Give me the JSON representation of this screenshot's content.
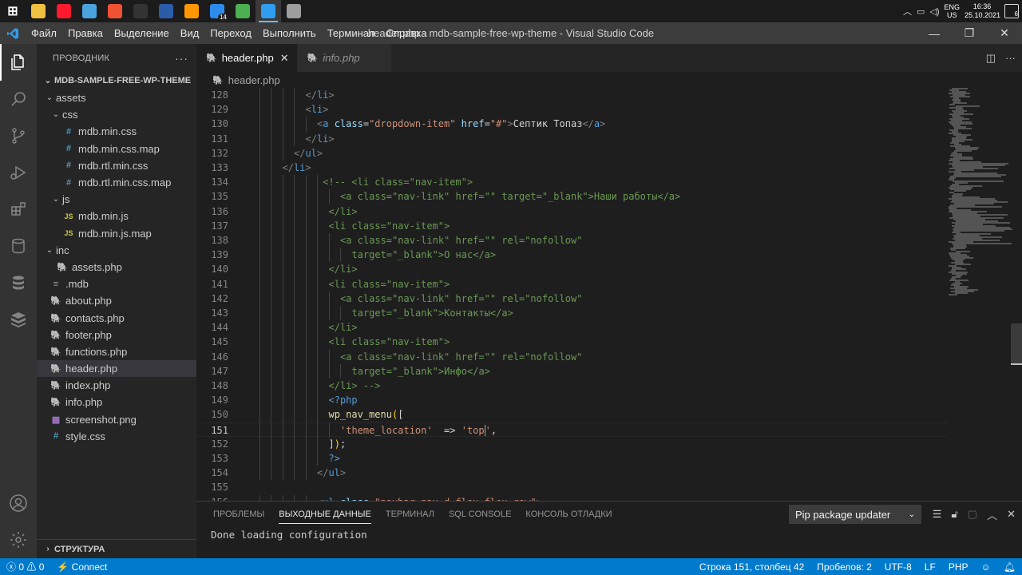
{
  "taskbar": {
    "apps": [
      {
        "icon": "windows-start-icon",
        "color": "#ffffff"
      },
      {
        "icon": "file-explorer-icon",
        "color": "#f0c040"
      },
      {
        "icon": "opera-icon",
        "color": "#ff1b2d"
      },
      {
        "icon": "notepad-icon",
        "color": "#4aa3df"
      },
      {
        "icon": "git-icon",
        "color": "#f05133"
      },
      {
        "icon": "terminal-icon",
        "color": "#333333"
      },
      {
        "icon": "b-app-icon",
        "color": "#2a5caa"
      },
      {
        "icon": "sublime-icon",
        "color": "#ff9800"
      },
      {
        "icon": "check-app-icon",
        "color": "#2d8ceb",
        "badge": "14"
      },
      {
        "icon": "chrome-icon",
        "color": "#4caf50"
      },
      {
        "icon": "vscode-icon",
        "color": "#2f9ef0",
        "active": true
      },
      {
        "icon": "app-window-icon",
        "color": "#9e9e9e"
      }
    ],
    "tray": {
      "lang": "ENG",
      "region": "US",
      "time": "16:36",
      "date": "25.10.2021",
      "notifications": "6"
    }
  },
  "titlebar": {
    "menu": [
      "Файл",
      "Правка",
      "Выделение",
      "Вид",
      "Переход",
      "Выполнить",
      "Терминал",
      "Справка"
    ],
    "title": "header.php - mdb-sample-free-wp-theme - Visual Studio Code"
  },
  "sidebar": {
    "header": "ПРОВОДНИК",
    "root": "MDB-SAMPLE-FREE-WP-THEME",
    "tree": [
      {
        "label": "assets",
        "type": "folder",
        "depth": 1,
        "open": true
      },
      {
        "label": "css",
        "type": "folder",
        "depth": 2,
        "open": true
      },
      {
        "label": "mdb.min.css",
        "type": "css",
        "depth": 3
      },
      {
        "label": "mdb.min.css.map",
        "type": "css",
        "depth": 3
      },
      {
        "label": "mdb.rtl.min.css",
        "type": "css",
        "depth": 3
      },
      {
        "label": "mdb.rtl.min.css.map",
        "type": "css",
        "depth": 3
      },
      {
        "label": "js",
        "type": "folder",
        "depth": 2,
        "open": true
      },
      {
        "label": "mdb.min.js",
        "type": "js",
        "depth": 3
      },
      {
        "label": "mdb.min.js.map",
        "type": "js",
        "depth": 3
      },
      {
        "label": "inc",
        "type": "folder",
        "depth": 1,
        "open": true
      },
      {
        "label": "assets.php",
        "type": "php",
        "depth": 2
      },
      {
        "label": ".mdb",
        "type": "dot",
        "depth": 1
      },
      {
        "label": "about.php",
        "type": "php",
        "depth": 1
      },
      {
        "label": "contacts.php",
        "type": "php",
        "depth": 1
      },
      {
        "label": "footer.php",
        "type": "php",
        "depth": 1
      },
      {
        "label": "functions.php",
        "type": "php",
        "depth": 1
      },
      {
        "label": "header.php",
        "type": "php",
        "depth": 1,
        "selected": true
      },
      {
        "label": "index.php",
        "type": "php",
        "depth": 1
      },
      {
        "label": "info.php",
        "type": "php",
        "depth": 1
      },
      {
        "label": "screenshot.png",
        "type": "png",
        "depth": 1
      },
      {
        "label": "style.css",
        "type": "css",
        "depth": 1
      }
    ],
    "outline": "СТРУКТУРА"
  },
  "editor": {
    "tabs": [
      {
        "label": "header.php",
        "active": true
      },
      {
        "label": "info.php",
        "active": false
      }
    ],
    "breadcrumb": "header.php",
    "current_line": 151,
    "lines": [
      {
        "n": "128",
        "indent": 10,
        "tokens": [
          [
            "t-tag",
            "</"
          ],
          [
            "t-name",
            "li"
          ],
          [
            "t-tag",
            ">"
          ]
        ]
      },
      {
        "n": "129",
        "indent": 10,
        "tokens": [
          [
            "t-tag",
            "<"
          ],
          [
            "t-name",
            "li"
          ],
          [
            "t-tag",
            ">"
          ]
        ]
      },
      {
        "n": "130",
        "indent": 12,
        "tokens": [
          [
            "t-tag",
            "<"
          ],
          [
            "t-name",
            "a"
          ],
          [
            "t-text",
            " "
          ],
          [
            "t-attr",
            "class"
          ],
          [
            "t-text",
            "="
          ],
          [
            "t-str",
            "\"dropdown-item\""
          ],
          [
            "t-text",
            " "
          ],
          [
            "t-attr",
            "href"
          ],
          [
            "t-text",
            "="
          ],
          [
            "t-str",
            "\"#\""
          ],
          [
            "t-tag",
            ">"
          ],
          [
            "t-text",
            "Септик Топаз"
          ],
          [
            "t-tag",
            "</"
          ],
          [
            "t-name",
            "a"
          ],
          [
            "t-tag",
            ">"
          ]
        ]
      },
      {
        "n": "131",
        "indent": 10,
        "tokens": [
          [
            "t-tag",
            "</"
          ],
          [
            "t-name",
            "li"
          ],
          [
            "t-tag",
            ">"
          ]
        ]
      },
      {
        "n": "132",
        "indent": 8,
        "tokens": [
          [
            "t-tag",
            "</"
          ],
          [
            "t-name",
            "ul"
          ],
          [
            "t-tag",
            ">"
          ]
        ]
      },
      {
        "n": "133",
        "indent": 6,
        "tokens": [
          [
            "t-tag",
            "</"
          ],
          [
            "t-name",
            "li"
          ],
          [
            "t-tag",
            ">"
          ]
        ]
      },
      {
        "n": "134",
        "indent": 13,
        "tokens": [
          [
            "t-comment",
            "<!-- <li class=\"nav-item\">"
          ]
        ]
      },
      {
        "n": "135",
        "indent": 16,
        "tokens": [
          [
            "t-comment",
            "<a class=\"nav-link\" href=\"\" target=\"_blank\">Наши работы</a>"
          ]
        ]
      },
      {
        "n": "136",
        "indent": 14,
        "tokens": [
          [
            "t-comment",
            "</li>"
          ]
        ]
      },
      {
        "n": "137",
        "indent": 14,
        "tokens": [
          [
            "t-comment",
            "<li class=\"nav-item\">"
          ]
        ]
      },
      {
        "n": "138",
        "indent": 16,
        "tokens": [
          [
            "t-comment",
            "<a class=\"nav-link\" href=\"\" rel=\"nofollow\""
          ]
        ]
      },
      {
        "n": "139",
        "indent": 18,
        "tokens": [
          [
            "t-comment",
            "target=\"_blank\">О нас</a>"
          ]
        ]
      },
      {
        "n": "140",
        "indent": 14,
        "tokens": [
          [
            "t-comment",
            "</li>"
          ]
        ]
      },
      {
        "n": "141",
        "indent": 14,
        "tokens": [
          [
            "t-comment",
            "<li class=\"nav-item\">"
          ]
        ]
      },
      {
        "n": "142",
        "indent": 16,
        "tokens": [
          [
            "t-comment",
            "<a class=\"nav-link\" href=\"\" rel=\"nofollow\""
          ]
        ]
      },
      {
        "n": "143",
        "indent": 18,
        "tokens": [
          [
            "t-comment",
            "target=\"_blank\">Контакты</a>"
          ]
        ]
      },
      {
        "n": "144",
        "indent": 14,
        "tokens": [
          [
            "t-comment",
            "</li>"
          ]
        ]
      },
      {
        "n": "145",
        "indent": 14,
        "tokens": [
          [
            "t-comment",
            "<li class=\"nav-item\">"
          ]
        ]
      },
      {
        "n": "146",
        "indent": 16,
        "tokens": [
          [
            "t-comment",
            "<a class=\"nav-link\" href=\"\" rel=\"nofollow\""
          ]
        ]
      },
      {
        "n": "147",
        "indent": 18,
        "tokens": [
          [
            "t-comment",
            "target=\"_blank\">Инфо</a>"
          ]
        ]
      },
      {
        "n": "148",
        "indent": 14,
        "tokens": [
          [
            "t-comment",
            "</li> -->"
          ]
        ]
      },
      {
        "n": "149",
        "indent": 14,
        "tokens": [
          [
            "t-php",
            "<?php"
          ]
        ]
      },
      {
        "n": "150",
        "indent": 14,
        "tokens": [
          [
            "t-fn",
            "wp_nav_menu"
          ],
          [
            "t-bracket",
            "("
          ],
          [
            "t-punc",
            "["
          ]
        ]
      },
      {
        "n": "151",
        "indent": 16,
        "tokens": [
          [
            "t-str",
            "'theme_location'"
          ],
          [
            "t-text",
            "  => "
          ],
          [
            "t-str",
            "'top"
          ],
          [
            "cursor",
            ""
          ],
          [
            "t-str",
            "'"
          ],
          [
            "t-text",
            ","
          ]
        ]
      },
      {
        "n": "152",
        "indent": 14,
        "tokens": [
          [
            "t-punc",
            "]"
          ],
          [
            "t-bracket",
            ")"
          ],
          [
            "t-text",
            ";"
          ]
        ]
      },
      {
        "n": "153",
        "indent": 14,
        "tokens": [
          [
            "t-php",
            "?>"
          ]
        ]
      },
      {
        "n": "154",
        "indent": 12,
        "tokens": [
          [
            "t-tag",
            "</"
          ],
          [
            "t-name",
            "ul"
          ],
          [
            "t-tag",
            ">"
          ]
        ]
      },
      {
        "n": "155",
        "indent": 0,
        "tokens": []
      },
      {
        "n": "156",
        "indent": 12,
        "tokens": [
          [
            "t-tag",
            "<"
          ],
          [
            "t-name",
            "ul"
          ],
          [
            "t-text",
            " "
          ],
          [
            "t-attr",
            "class"
          ],
          [
            "t-text",
            "="
          ],
          [
            "t-str",
            "\"navbar-nav d-flex flex-row\""
          ],
          [
            "t-tag",
            ">"
          ]
        ]
      }
    ]
  },
  "panel": {
    "tabs": [
      "ПРОБЛЕМЫ",
      "ВЫХОДНЫЕ ДАННЫЕ",
      "ТЕРМИНАЛ",
      "SQL CONSOLE",
      "КОНСОЛЬ ОТЛАДКИ"
    ],
    "active_tab": 1,
    "output_channel": "Pip package updater",
    "output_text": "Done loading configuration"
  },
  "statusbar": {
    "errors": "0",
    "warnings": "0",
    "connect": "Connect",
    "position": "Строка 151, столбец 42",
    "spaces": "Пробелов: 2",
    "encoding": "UTF-8",
    "eol": "LF",
    "language": "PHP"
  }
}
